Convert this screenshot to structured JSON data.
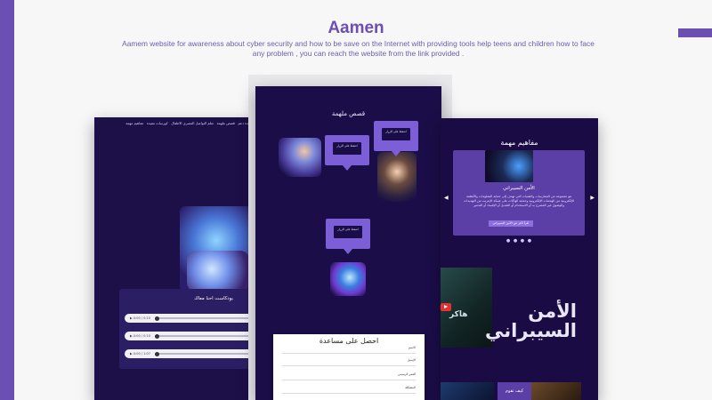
{
  "page": {
    "title": "Aamen",
    "subtitle": "Aamem website for awareness about cyber security and how to be save on the Internet with providing tools help teens and children how to face any problem , you can reach the website from the link provided ."
  },
  "left_mockup": {
    "nav": [
      "مفاهيم مهمة",
      "كورسات مفيدة",
      "تعلم التواصل المصري الاطفال",
      "قصص ملهمة",
      "مساعدة دعم"
    ],
    "podcast_title": "بودكاست احنا معاك",
    "players": [
      "0:00 / 0:10",
      "0:00 / 0:10",
      "0:00 / 1:07"
    ]
  },
  "center_mockup": {
    "heading": "قصص ملهمة",
    "bubble_button": "اضغط على الزرار",
    "help_title": "احصل على مساعدة",
    "help_fields": [
      "الاسم",
      "الإيميل",
      "العمر الرسمي",
      "المشكلة"
    ]
  },
  "right_mockup": {
    "heading": "مفاهيم مهمة",
    "card_title": "الأمن السيبراني",
    "card_desc": "هو مجموعة من الممارسات والتقنيات التي تهدف إلى حماية المعلومات والأنظمة الإلكترونية من الهجمات الإلكترونية وحماية الهاكات على شبكة الإنترنت من التهديدات والوصول غير المصرح به أو الاستخدام أو التعديل أو الإفساد أو التدمير",
    "card_button": "اقرأ اكثر عن الأمن السيبراني",
    "video_text": "هاكر",
    "big_title_line1": "الأمن",
    "big_title_line2": "السيبراني",
    "bottom_label": "كيف تقوم"
  },
  "colors": {
    "accent": "#6b4fb3",
    "dark_bg": "#1b0d48",
    "bubble": "#7c5fd6"
  }
}
